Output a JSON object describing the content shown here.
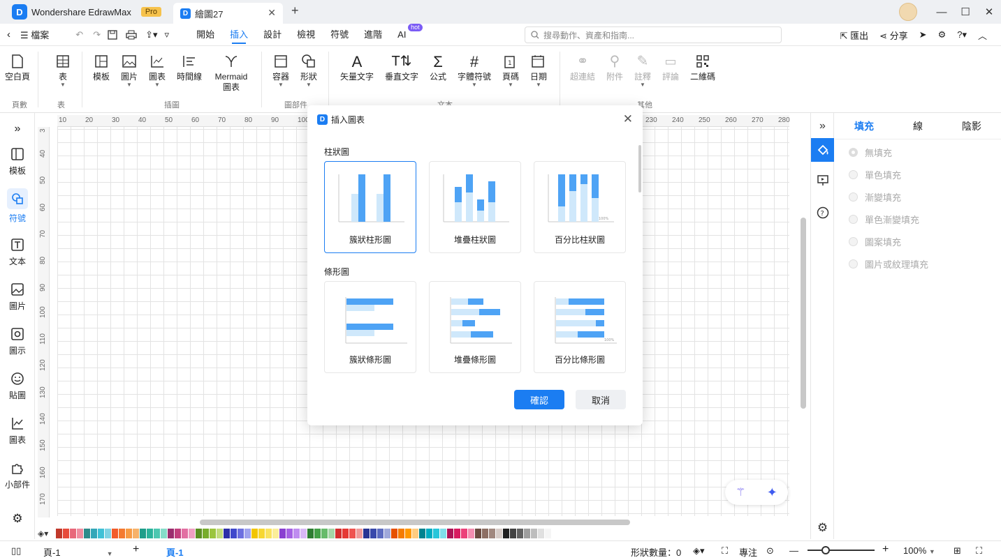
{
  "app": {
    "name": "Wondershare EdrawMax",
    "badge": "Pro"
  },
  "doc_tab": {
    "title": "繪圖27"
  },
  "menubar": {
    "file": "檔案",
    "tabs": [
      "開始",
      "插入",
      "設計",
      "檢視",
      "符號",
      "進階",
      "AI"
    ],
    "ai_badge": "hot",
    "search_placeholder": "搜尋動作、資產和指南...",
    "export": "匯出",
    "share": "分享"
  },
  "ribbon": {
    "blank_page": "空白頁",
    "table": "表",
    "template": "模板",
    "picture": "圖片",
    "chart": "圖表",
    "timeline": "時間線",
    "mermaid": "Mermaid 圖表",
    "container": "容器",
    "shape": "形狀",
    "vector_text": "矢量文字",
    "vertical_text": "垂直文字",
    "formula": "公式",
    "font_symbol": "字體符號",
    "page_number": "頁碼",
    "date": "日期",
    "hyperlink": "超連結",
    "attachment": "附件",
    "annotation": "註釋",
    "comment": "評論",
    "qrcode": "二維碼",
    "groups": {
      "pages": "頁數",
      "table": "表",
      "illustration": "插圖",
      "parts": "圖部件",
      "text": "文本",
      "other": "其他"
    }
  },
  "leftbar": [
    "模板",
    "符號",
    "文本",
    "圖片",
    "圖示",
    "貼圖",
    "圖表",
    "小部件"
  ],
  "hruler": [
    "10",
    "20",
    "30",
    "40",
    "50",
    "60",
    "70",
    "80",
    "90",
    "100",
    "230",
    "240",
    "250",
    "260",
    "270",
    "280"
  ],
  "vruler": [
    "3",
    "40",
    "50",
    "60",
    "70",
    "80",
    "90",
    "100",
    "110",
    "120",
    "130",
    "140",
    "150",
    "160",
    "170"
  ],
  "dialog": {
    "title": "插入圖表",
    "section1": "柱狀圖",
    "section2": "條形圖",
    "cards1": [
      "簇狀柱形圖",
      "堆疊柱狀圖",
      "百分比柱狀圖"
    ],
    "cards2": [
      "簇狀條形圖",
      "堆疊條形圖",
      "百分比條形圖"
    ],
    "pct_label": "100%",
    "ok": "確認",
    "cancel": "取消"
  },
  "rpanel": {
    "tabs": [
      "填充",
      "線",
      "陰影"
    ],
    "options": [
      "無填充",
      "單色填充",
      "漸變填充",
      "單色漸變填充",
      "圖案填充",
      "圖片或紋理填充"
    ]
  },
  "status": {
    "page_select": "頁-1",
    "page_tab": "頁-1",
    "shape_count": "形狀數量：0",
    "focus": "專注",
    "zoom": "100%"
  },
  "colors": {
    "accent": "#1b7df2",
    "palette": [
      "#c0392b",
      "#e74c3c",
      "#e8677a",
      "#f08ca0",
      "#2e8b8b",
      "#34a7b8",
      "#3fc1d6",
      "#7fd3e3",
      "#f25c2a",
      "#f47a30",
      "#f79b45",
      "#f7b26a",
      "#1f9e8a",
      "#2bb39b",
      "#4dc7b0",
      "#86dcc9",
      "#9b2d6e",
      "#c2407e",
      "#e26fa2",
      "#ef9fc2",
      "#5b8f22",
      "#77ac2b",
      "#9bc53d",
      "#c2dc7c",
      "#2d2fa8",
      "#3f48cc",
      "#6c6fe0",
      "#a0a3ee",
      "#f2c500",
      "#f7d731",
      "#f9e35f",
      "#fbee99",
      "#8a3fd1",
      "#a561e3",
      "#bf8cf0",
      "#d9b8f6",
      "#2e7d32",
      "#43a047",
      "#66bb6a",
      "#a5d6a7",
      "#d32f2f",
      "#e53935",
      "#ef5350",
      "#ef9a9a",
      "#283593",
      "#3949ab",
      "#5c6bc0",
      "#9fa8da",
      "#e65100",
      "#f57c00",
      "#ff9800",
      "#ffcc80",
      "#00838f",
      "#00acc1",
      "#26c6da",
      "#80deea",
      "#ad1457",
      "#d81b60",
      "#ec407a",
      "#f48fb1",
      "#6d4c41",
      "#8d6e63",
      "#a1887f",
      "#d7ccc8",
      "#212121",
      "#424242",
      "#616161",
      "#9e9e9e",
      "#bdbdbd",
      "#e0e0e0",
      "#f5f5f5"
    ]
  }
}
